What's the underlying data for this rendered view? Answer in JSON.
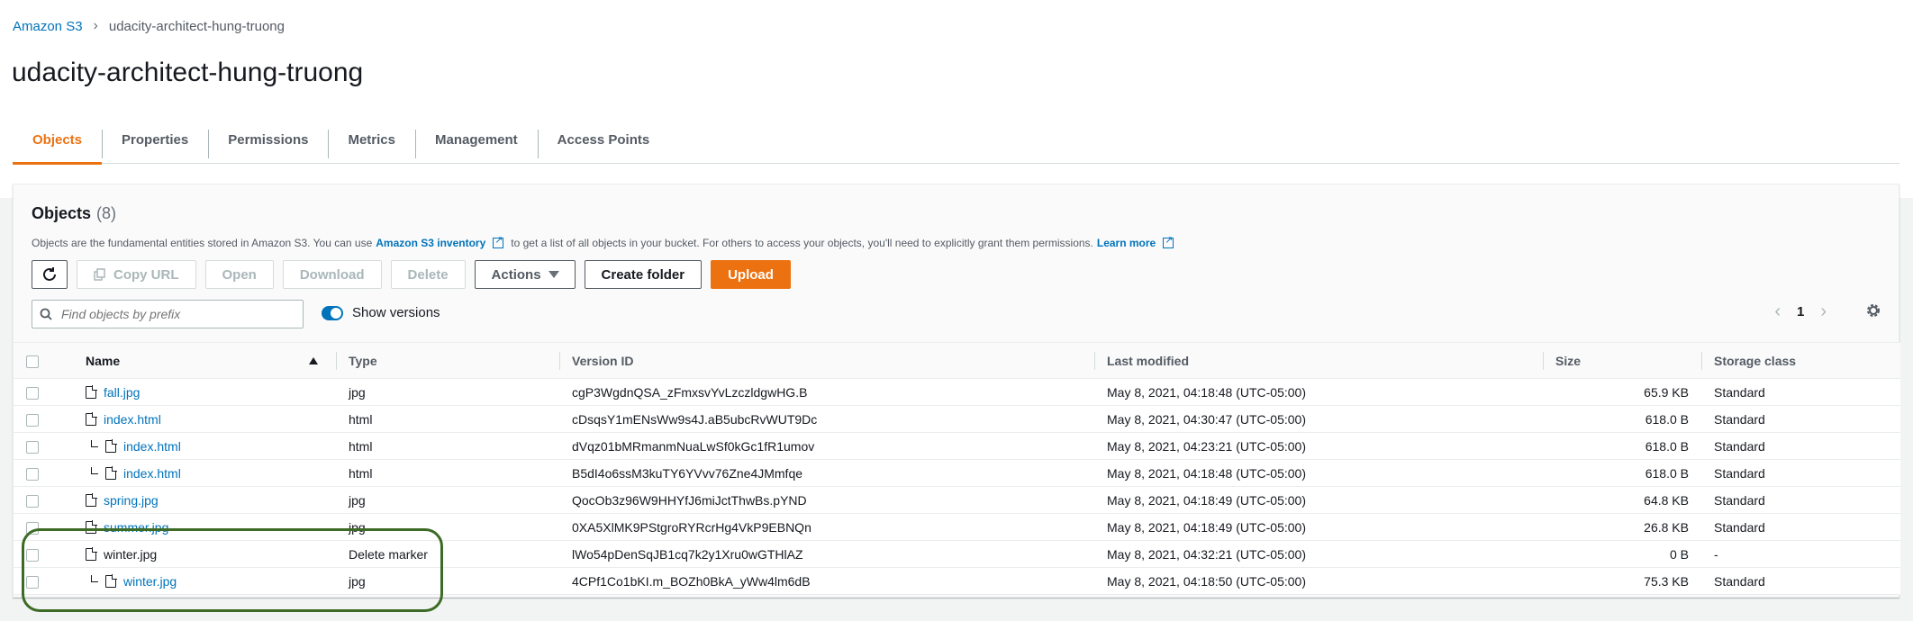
{
  "breadcrumb": {
    "root": "Amazon S3",
    "current": "udacity-architect-hung-truong"
  },
  "bucket_name": "udacity-architect-hung-truong",
  "tabs": [
    "Objects",
    "Properties",
    "Permissions",
    "Metrics",
    "Management",
    "Access Points"
  ],
  "active_tab": "Objects",
  "panel": {
    "title": "Objects",
    "count": "(8)",
    "desc_pre": "Objects are the fundamental entities stored in Amazon S3. You can use",
    "desc_link": "Amazon S3 inventory",
    "desc_mid": "to get a list of all objects in your bucket. For others to access your objects, you'll need to explicitly grant them permissions.",
    "learn_more": "Learn more"
  },
  "toolbar": {
    "copy_url": "Copy URL",
    "open": "Open",
    "download": "Download",
    "delete": "Delete",
    "actions": "Actions",
    "create_folder": "Create folder",
    "upload": "Upload"
  },
  "search": {
    "placeholder": "Find objects by prefix"
  },
  "show_versions": "Show versions",
  "pager": {
    "page": "1"
  },
  "columns": [
    "Name",
    "Type",
    "Version ID",
    "Last modified",
    "Size",
    "Storage class"
  ],
  "rows": [
    {
      "name": "fall.jpg",
      "type": "jpg",
      "version": "cgP3WgdnQSA_zFmxsvYvLzczldgwHG.B",
      "modified": "May 8, 2021, 04:18:48 (UTC-05:00)",
      "size": "65.9 KB",
      "storage": "Standard"
    },
    {
      "name": "index.html",
      "type": "html",
      "version": "cDsqsY1mENsWw9s4J.aB5ubcRvWUT9Dc",
      "modified": "May 8, 2021, 04:30:47 (UTC-05:00)",
      "size": "618.0 B",
      "storage": "Standard"
    },
    {
      "name": "index.html",
      "type": "html",
      "version": "dVqz01bMRmanmNuaLwSf0kGc1fR1umov",
      "modified": "May 8, 2021, 04:23:21 (UTC-05:00)",
      "size": "618.0 B",
      "storage": "Standard"
    },
    {
      "name": "index.html",
      "type": "html",
      "version": "B5dI4o6ssM3kuTY6YVvv76Zne4JMmfqe",
      "modified": "May 8, 2021, 04:18:48 (UTC-05:00)",
      "size": "618.0 B",
      "storage": "Standard"
    },
    {
      "name": "spring.jpg",
      "type": "jpg",
      "version": "QocOb3z96W9HHYfJ6miJctThwBs.pYND",
      "modified": "May 8, 2021, 04:18:49 (UTC-05:00)",
      "size": "64.8 KB",
      "storage": "Standard"
    },
    {
      "name": "summer.jpg",
      "type": "jpg",
      "version": "0XA5XlMK9PStgroRYRcrHg4VkP9EBNQn",
      "modified": "May 8, 2021, 04:18:49 (UTC-05:00)",
      "size": "26.8 KB",
      "storage": "Standard"
    },
    {
      "name": "winter.jpg",
      "type": "Delete marker",
      "version": "lWo54pDenSqJB1cq7k2y1Xru0wGTHlAZ",
      "modified": "May 8, 2021, 04:32:21 (UTC-05:00)",
      "size": "0 B",
      "storage": "-"
    },
    {
      "name": "winter.jpg",
      "type": "jpg",
      "version": "4CPf1Co1bKI.m_BOZh0BkA_yWw4lm6dB",
      "modified": "May 8, 2021, 04:18:50 (UTC-05:00)",
      "size": "75.3 KB",
      "storage": "Standard"
    }
  ]
}
